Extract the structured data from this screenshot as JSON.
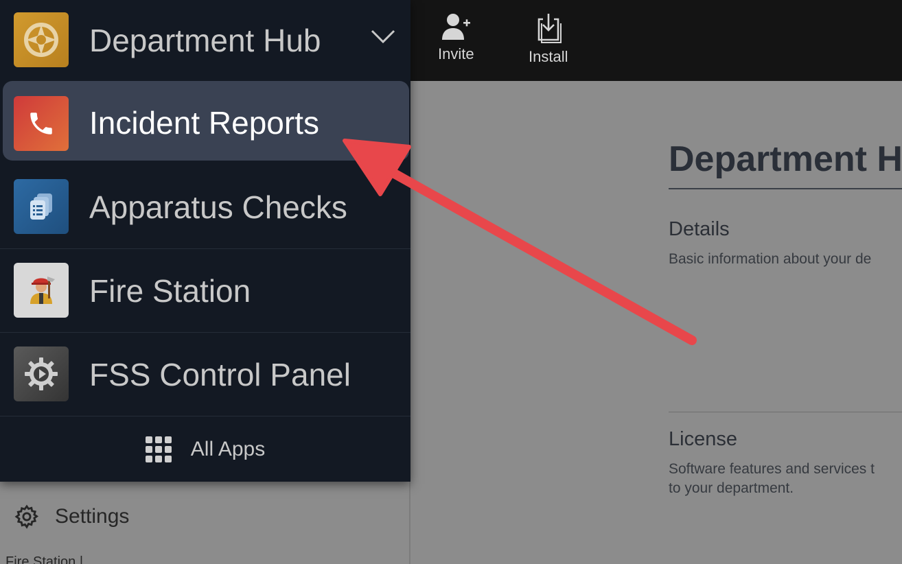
{
  "toolbar": {
    "invite_label": "Invite",
    "install_label": "Install"
  },
  "main": {
    "title": "Department H",
    "details": {
      "title": "Details",
      "description": "Basic information about your de"
    },
    "license": {
      "title": "License",
      "description_line1": "Software features and services t",
      "description_line2": "to your department."
    }
  },
  "sidebar": {
    "settings_label": "Settings",
    "subheading": "Fire Station |"
  },
  "app_switcher": {
    "current": {
      "label": "Department Hub",
      "icon": "department-hub-icon",
      "color": "#c8902a"
    },
    "items": [
      {
        "label": "Incident Reports",
        "icon": "phone-icon",
        "color": "#d9473a",
        "active": true
      },
      {
        "label": "Apparatus Checks",
        "icon": "checklist-icon",
        "color": "#2a5f92",
        "active": false
      },
      {
        "label": "Fire Station",
        "icon": "firefighter-icon",
        "color": "#d8d8d8",
        "active": false
      },
      {
        "label": "FSS Control Panel",
        "icon": "gear-icon",
        "color": "#4a4a4a",
        "active": false
      }
    ],
    "all_apps_label": "All Apps"
  },
  "annotation": {
    "color": "#e8474b"
  }
}
